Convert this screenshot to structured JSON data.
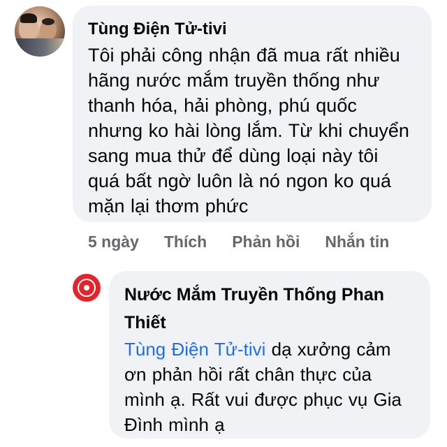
{
  "comment": {
    "author": "Tùng Điện Tử-tivi",
    "lines": [
      "Tôi phải công nhận đã mua rất nhiều",
      "hãng nước mắm truyền thống như",
      "thanh hóa, hải phòng, phú quốc",
      "nhưng ko hài lòng lắm. Từ khi chuyển",
      "sang mua thử để dùng loại này tôi",
      "quá bất ngờ luôn là nó ngon ko quá",
      "mặn lại thơm phức"
    ],
    "actions": {
      "time": "5 ngày",
      "like": "Thích",
      "reply": "Phản hồi",
      "message": "Nhắn tin"
    }
  },
  "reply": {
    "author_line1": "Nước Mắm Truyền Thống Phan",
    "author_line2": "Thiết",
    "mention": "Tùng Điện Tử-tivi",
    "line1_rest": " dạ xưởng cảm",
    "lines": [
      "ơn phản hồi rất chân thực của",
      "mình ạ. Rất vui được phục vụ Gia",
      "Đình mình ạ"
    ]
  }
}
